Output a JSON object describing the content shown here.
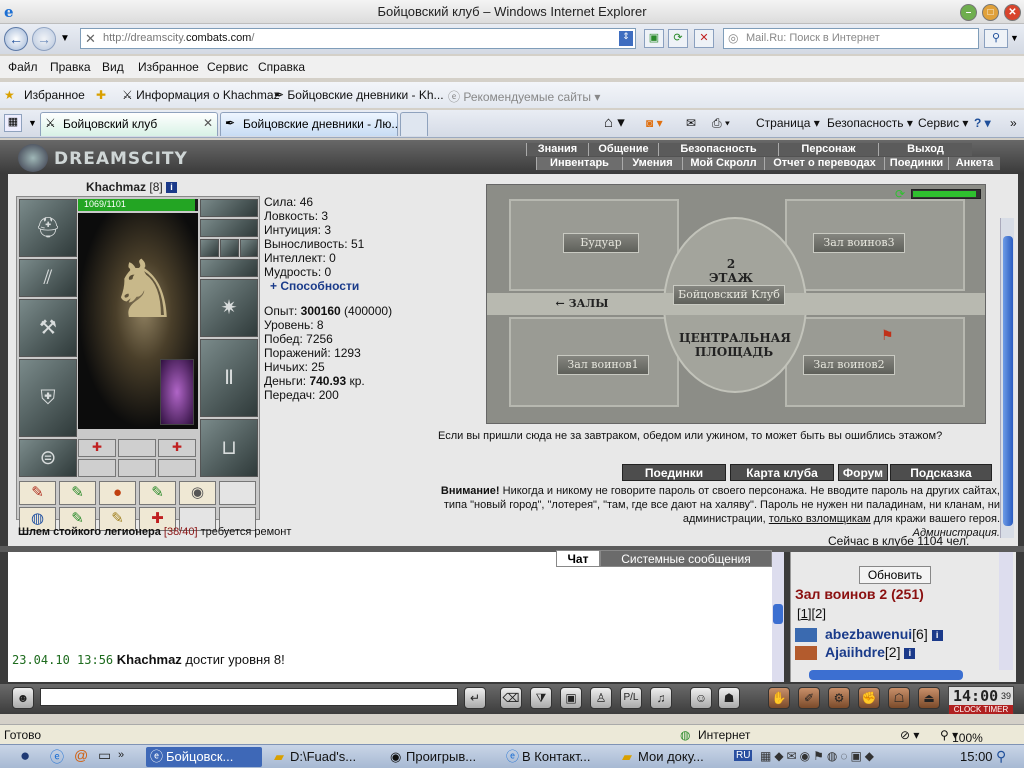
{
  "window": {
    "title": "Бойцовский клуб – Windows Internet Explorer",
    "min_glyph": "–",
    "max_glyph": "□",
    "close_glyph": "✕"
  },
  "addressbar": {
    "url_prefix": "http://dreamscity.",
    "url_domain": "combats.com",
    "url_suffix": "/",
    "search_placeholder": "Mail.Ru: Поиск в Интернет"
  },
  "menu": [
    "Файл",
    "Правка",
    "Вид",
    "Избранное",
    "Сервис",
    "Справка"
  ],
  "favorites": {
    "label": "Избранное",
    "items": [
      "Информация о Khachmaz",
      "Бойцовские дневники - Kh...",
      "Рекомендуемые сайты"
    ]
  },
  "tabs": [
    {
      "label": "Бойцовский клуб",
      "active": true
    },
    {
      "label": "Бойцовские дневники - Лю...",
      "active": false
    }
  ],
  "commandbar": [
    "Страница",
    "Безопасность",
    "Сервис"
  ],
  "game": {
    "logo": "DREAMSCITY",
    "nav_top": [
      "Знания",
      "Общение",
      "Безопасность",
      "Персонаж",
      "Выход"
    ],
    "nav_bottom": [
      "Инвентарь",
      "Умения",
      "Мой Скролл",
      "Отчет о переводах",
      "Поединки",
      "Анкета"
    ],
    "character": {
      "name": "Khachmaz",
      "level": "[8]",
      "hp_text": "1069/1101",
      "hp_fraction": 0.971
    },
    "stats": [
      {
        "label": "Сила:",
        "value": "46"
      },
      {
        "label": "Ловкость:",
        "value": "3"
      },
      {
        "label": "Интуиция:",
        "value": "3"
      },
      {
        "label": "Выносливость:",
        "value": "51"
      },
      {
        "label": "Интеллект:",
        "value": "0"
      },
      {
        "label": "Мудрость:",
        "value": "0"
      }
    ],
    "abilities_link": "+ Способности",
    "experience": {
      "label": "Опыт:",
      "value": "300160",
      "next": "(400000)"
    },
    "level_line": {
      "label": "Уровень:",
      "value": "8"
    },
    "wins": {
      "label": "Побед:",
      "value": "7256"
    },
    "losses": {
      "label": "Поражений:",
      "value": "1293"
    },
    "draws": {
      "label": "Ничьих:",
      "value": "25"
    },
    "money": {
      "label": "Деньги:",
      "value": "740.93",
      "unit": "кр."
    },
    "transfers": {
      "label": "Передач:",
      "value": "200"
    },
    "item_note": {
      "name": "Шлем стойкого легионера",
      "durability": "[38/40]",
      "rest": "требуется ремонт"
    },
    "map": {
      "floor": "2 ЭТАЖ",
      "center": "Бойцовский Клуб",
      "halls": "ЗАЛЫ",
      "square": "ЦЕНТРАЛЬНАЯ ПЛОЩАДЬ",
      "rooms": [
        "Будуар",
        "Зал воинов3",
        "Зал воинов1",
        "Зал воинов2"
      ],
      "indicator_fraction": 0.95
    },
    "question": "Если вы пришли сюда не за завтраком, обедом или ужином, то может быть вы ошиблись этажом?",
    "buttons": [
      "Поединки",
      "Карта клуба",
      "Форум",
      "Подсказка"
    ],
    "warning": {
      "bold": "Внимание!",
      "text1": " Никогда и никому не говорите пароль от своего персонажа. Не вводите пароль на других сайтах, типа \"новый город\", \"лотерея\", \"там, где все дают на халяву\". Пароль не нужен ни паладинам, ни кланам, ни администрации, ",
      "link": "только взломщикам",
      "text2": " для кражи вашего героя.",
      "admin": "Администрация."
    },
    "online": "Сейчас в клубе 1104 чел."
  },
  "chat": {
    "tabs": [
      "Чат",
      "Системные сообщения"
    ],
    "message": {
      "timestamp": "23.04.10 13:56",
      "user": "Khachmaz",
      "text": " достиг уровня 8!"
    },
    "refresh": "Обновить",
    "room": "Зал воинов 2 (251)",
    "pages_open": "[",
    "page_current": "1",
    "pages_rest": "][2]",
    "users": [
      {
        "name": "abezbawenui",
        "level": "[6]"
      },
      {
        "name": "Ajaiihdre",
        "level": "[2]"
      }
    ]
  },
  "clock": {
    "time": "14:00",
    "sec": "39",
    "label": "CLOCK TIMER"
  },
  "statusbar": {
    "left": "Готово",
    "zone": "Интернет",
    "zoom": "100%"
  },
  "taskbar": {
    "tasks": [
      "Бойцовск...",
      "D:\\Fuad's...",
      "Проигрыв...",
      "В Контакт...",
      "Мои доку..."
    ],
    "lang": "RU",
    "time": "15:00"
  },
  "colors": {
    "accent": "#1a3b8a",
    "room": "#8b1010",
    "hp": "#23a523",
    "timestamp": "#1e6b1e"
  }
}
